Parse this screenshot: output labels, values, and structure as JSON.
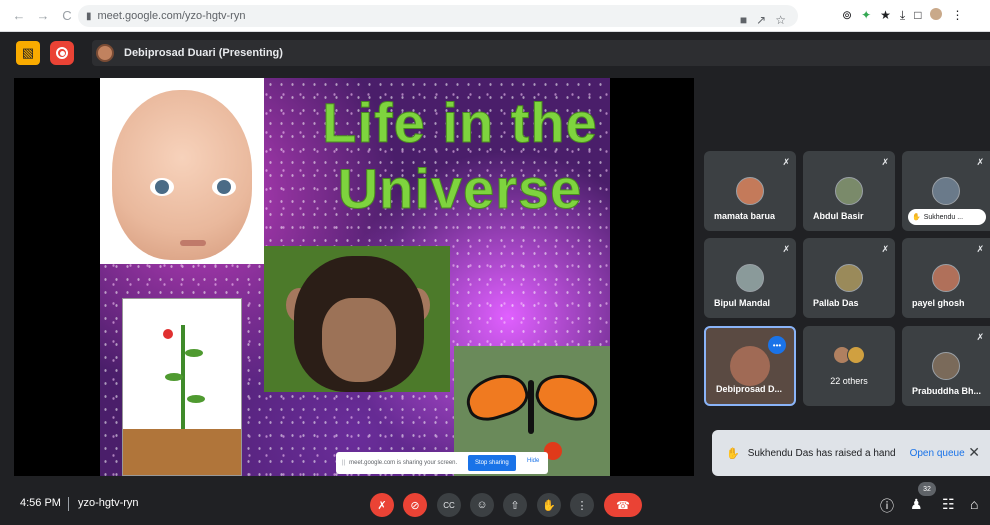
{
  "browser": {
    "url": "meet.google.com/yzo-hgtv-ryn",
    "back_icon": "←",
    "forward_icon": "→",
    "reload_icon": "C",
    "lock_icon": "▮",
    "omni_icons": [
      "■",
      "↗",
      "☆"
    ],
    "ext_icons": [
      "⊚",
      "✦",
      "★",
      "⤓",
      "□",
      "⋮"
    ]
  },
  "header": {
    "presenter_label": "Debiprosad Duari (Presenting)",
    "present_icon": "▧"
  },
  "slide": {
    "title_line1": "Life in the",
    "title_line2": "Universe"
  },
  "share_bar": {
    "message": "meet.google.com is sharing your screen.",
    "grip": "||",
    "stop_label": "Stop sharing",
    "hide_label": "Hide"
  },
  "participants": [
    {
      "name": "mamata barua"
    },
    {
      "name": "Abdul Basir"
    },
    {
      "name": "Sukhendu ..."
    },
    {
      "name": "Bipul Mandal"
    },
    {
      "name": "Pallab Das"
    },
    {
      "name": "payel ghosh"
    },
    {
      "name": "Debiprosad D..."
    },
    {
      "name": "22 others"
    },
    {
      "name": "Prabuddha Bh..."
    }
  ],
  "mic_off_icon": "✗",
  "more_icon": "•••",
  "hand_icon": "✋",
  "toast": {
    "message": "Sukhendu Das has raised a hand",
    "action": "Open queue",
    "close_icon": "✕"
  },
  "bottom": {
    "time": "4:56 PM",
    "meeting_code": "yzo-hgtv-ryn",
    "controls": {
      "mic": "✗",
      "camera": "⊘",
      "captions": "CC",
      "emoji": "☺",
      "present": "⇧",
      "hand": "✋",
      "more": "⋮",
      "hangup": "☎"
    },
    "info_icon": "ⓘ",
    "people_icon": "♟",
    "people_count": "32",
    "chat_icon": "☷",
    "activities_icon": "⌂"
  }
}
